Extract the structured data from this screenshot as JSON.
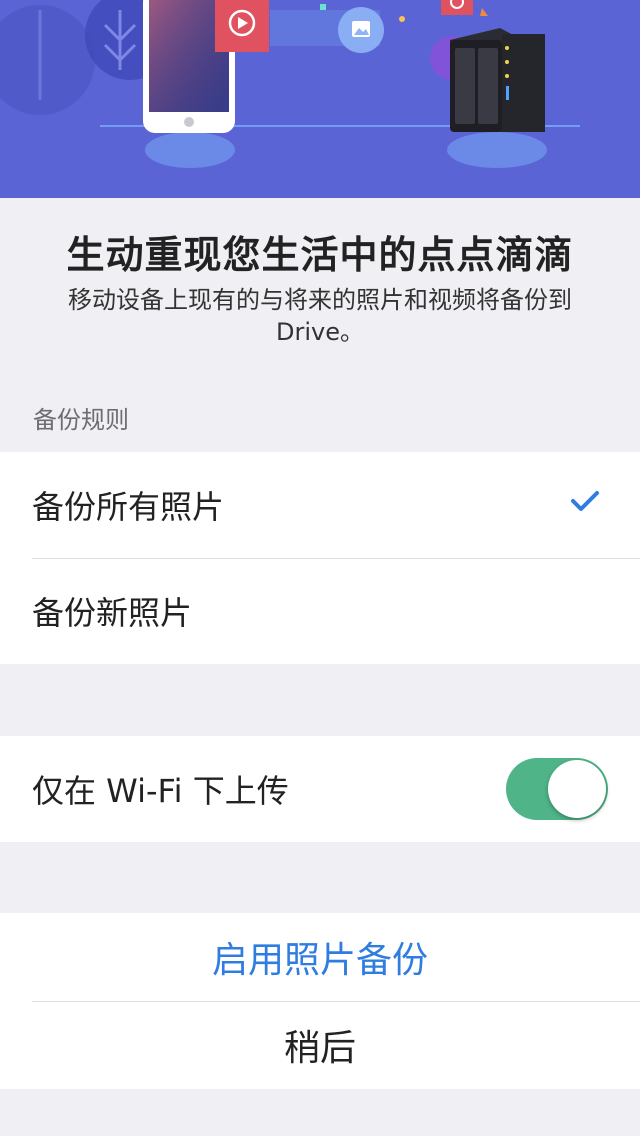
{
  "intro": {
    "title": "生动重现您生活中的点点滴滴",
    "description": "移动设备上现有的与将来的照片和视频将备份到 Drive。"
  },
  "backup_rule": {
    "header": "备份规则",
    "options": [
      {
        "label": "备份所有照片",
        "selected": true
      },
      {
        "label": "备份新照片",
        "selected": false
      }
    ]
  },
  "wifi_only": {
    "label": "仅在 Wi-Fi 下上传",
    "enabled": true
  },
  "actions": {
    "enable_label": "启用照片备份",
    "later_label": "稍后"
  },
  "colors": {
    "hero_bg": "#5b64d4",
    "accent_blue": "#2f7de1",
    "toggle_on": "#4fb589",
    "page_bg": "#efeff4"
  },
  "icons": [
    "play-icon",
    "image-icon",
    "checkmark-icon",
    "nas-device-icon",
    "phone-device-icon"
  ]
}
